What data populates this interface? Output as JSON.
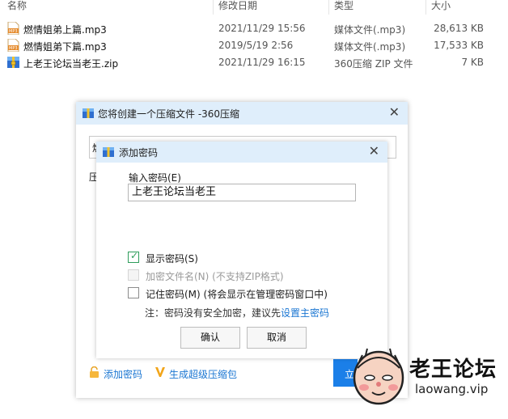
{
  "explorer": {
    "columns": [
      "名称",
      "修改日期",
      "类型",
      "大小"
    ],
    "files": [
      {
        "icon": "mp3-file-icon",
        "name": "燃情姐弟上篇.mp3",
        "date": "2021/11/29 15:56",
        "type": "媒体文件(.mp3)",
        "size": "28,613 KB"
      },
      {
        "icon": "mp3-file-icon",
        "name": "燃情姐弟下篇.mp3",
        "date": "2019/5/19 2:56",
        "type": "媒体文件(.mp3)",
        "size": "17,533 KB"
      },
      {
        "icon": "zip-archive-icon",
        "name": "上老王论坛当老王.zip",
        "date": "2021/11/29 16:15",
        "type": "360压缩 ZIP 文件",
        "size": "7 KB"
      }
    ]
  },
  "compress_dialog": {
    "title": "您将创建一个压缩文件 -360压缩",
    "close": "✕",
    "hidden_input_char": "燃",
    "hidden_label_char": "压",
    "add_password_link": "添加密码",
    "super_compress_link": "生成超级压缩包",
    "primary_button_partial": "立"
  },
  "password_dialog": {
    "title": "添加密码",
    "close": "✕",
    "input_label": "输入密码(E)",
    "password_value": "上老王论坛当老王",
    "show_password": {
      "label": "显示密码(S)",
      "checked": true
    },
    "encrypt_filenames": {
      "label": "加密文件名(N) (不支持ZIP格式)",
      "checked": false,
      "disabled": true
    },
    "remember_password": {
      "label": "记住密码(M) (将会显示在管理密码窗口中)",
      "checked": false
    },
    "note_prefix": "注：密码没有安全加密，建议先",
    "note_link": "设置主密码",
    "ok_label": "确认",
    "cancel_label": "取消"
  },
  "watermark": {
    "title": "老王论坛",
    "url": "laowang.vip"
  },
  "colors": {
    "title_bar": "#dfeefb",
    "link": "#1a76d2",
    "primary_button": "#1b7fe8",
    "check": "#2e9d5b"
  }
}
